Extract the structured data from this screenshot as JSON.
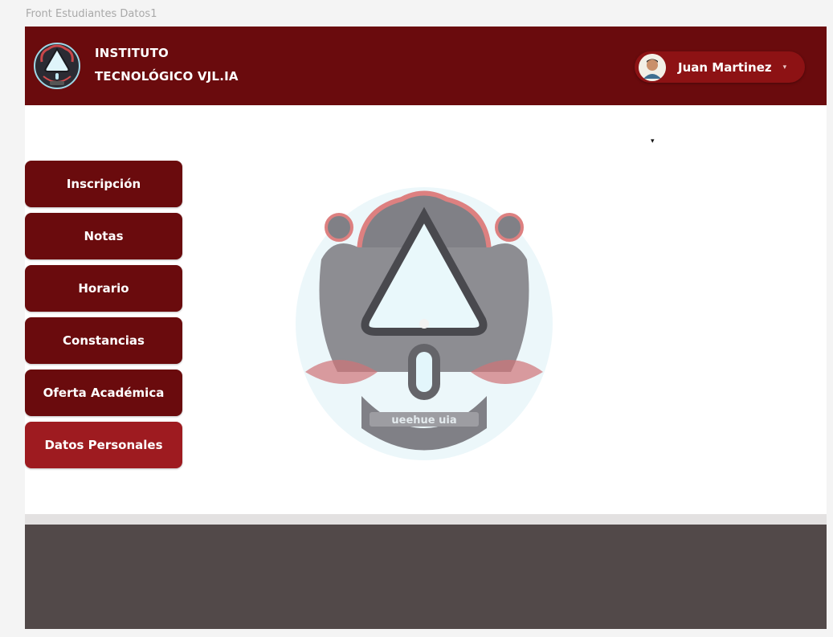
{
  "frame": {
    "label": "Front Estudiantes Datos1"
  },
  "header": {
    "brand_line1": "INSTITUTO",
    "brand_line2": "TECNOLÓGICO VJL.IA",
    "user": {
      "name": "Juan Martinez",
      "avatar_icon": "user-avatar-icon",
      "caret": "▾"
    }
  },
  "content": {
    "caret": "▾"
  },
  "menu": {
    "items": [
      {
        "label": "Inscripción"
      },
      {
        "label": "Notas"
      },
      {
        "label": "Horario"
      },
      {
        "label": "Constancias"
      },
      {
        "label": "Oferta Académica"
      },
      {
        "label": "Datos Personales",
        "active": true
      }
    ]
  },
  "colors": {
    "primary": "#6a0b0d",
    "active": "#9e1b20",
    "footer": "#524949"
  }
}
